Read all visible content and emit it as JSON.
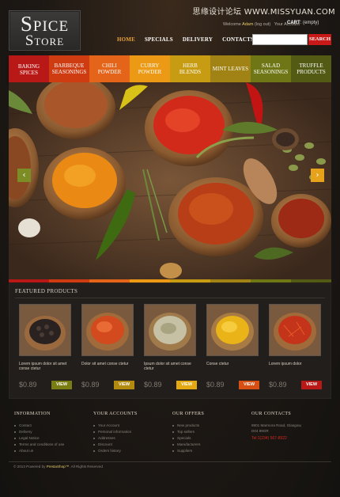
{
  "watermark": "思缘设计论坛  WWW.MISSYUAN.COM",
  "logo": {
    "line1": "Spice",
    "line2": "Store"
  },
  "userbar": {
    "welcome": "Welcome",
    "name": "Adam",
    "logout": "(log out)",
    "account": "Your Account"
  },
  "cart": {
    "label": "CART",
    "status": ": (empty)"
  },
  "nav": [
    {
      "label": "HOME",
      "active": true
    },
    {
      "label": "SPECIALS",
      "active": false
    },
    {
      "label": "DELIVERY",
      "active": false
    },
    {
      "label": "CONTACTS",
      "active": false
    }
  ],
  "search": {
    "placeholder": "",
    "button": "SEARCH"
  },
  "categories": [
    {
      "label": "BAKING SPICES",
      "color": "#b81917",
      "active": true
    },
    {
      "label": "BARBEQUE SEASONINGS",
      "color": "#cf3c12"
    },
    {
      "label": "CHILI POWDER",
      "color": "#e4641a"
    },
    {
      "label": "CURRY POWDER",
      "color": "#ec9a15"
    },
    {
      "label": "HERB BLENDS",
      "color": "#c79b12"
    },
    {
      "label": "MINT LEAVES",
      "color": "#a08314"
    },
    {
      "label": "SALAD SEASONINGS",
      "color": "#6f7615"
    },
    {
      "label": "TRUFFLE PRODUCTS",
      "color": "#525a13"
    }
  ],
  "featured": {
    "title": "FEATURED PRODUCTS",
    "products": [
      {
        "desc": "Lorem ipsum dolor sit amet conse ctetur",
        "price": "$0.89",
        "view": "VIEW",
        "view_color": "#7a7d12",
        "image": "peppercorns"
      },
      {
        "desc": "Dolor sit amet conse ctetur",
        "price": "$0.89",
        "view": "VIEW",
        "view_color": "#b38a10",
        "image": "paprika"
      },
      {
        "desc": "Ipsum dolor sit amet conse ctetur",
        "price": "$0.89",
        "view": "VIEW",
        "view_color": "#e4a812",
        "image": "herb-blend"
      },
      {
        "desc": "Conse ctetur",
        "price": "$0.89",
        "view": "VIEW",
        "view_color": "#d84f13",
        "image": "turmeric"
      },
      {
        "desc": "Lorem ipsum dolor",
        "price": "$0.89",
        "view": "VIEW",
        "view_color": "#b81917",
        "image": "saffron"
      }
    ]
  },
  "footer": {
    "information": {
      "title": "INFORMATION",
      "items": [
        "Contact",
        "Delivery",
        "Legal Notice",
        "Terms and conditions of use",
        "About us"
      ]
    },
    "account": {
      "title": "YOUR ACCOUNTS",
      "items": [
        "Your Account",
        "Personal information",
        "Addresses",
        "Discount",
        "Orders history"
      ]
    },
    "offers": {
      "title": "OUR OFFERS",
      "items": [
        "New products",
        "Top sellers",
        "Specials",
        "Manufacturers",
        "Suppliers"
      ]
    },
    "contacts": {
      "title": "OUR CONTACTS",
      "address1": "8901 Marmora Road, Glasgow,",
      "address2": "D04 89GR",
      "tel": "Tel:1(234) 567-8922"
    },
    "copyright_prefix": "© 2013 Powered by",
    "copyright_brand": "PrestaShop™",
    "copyright_suffix": ". All Rights Reserved"
  }
}
